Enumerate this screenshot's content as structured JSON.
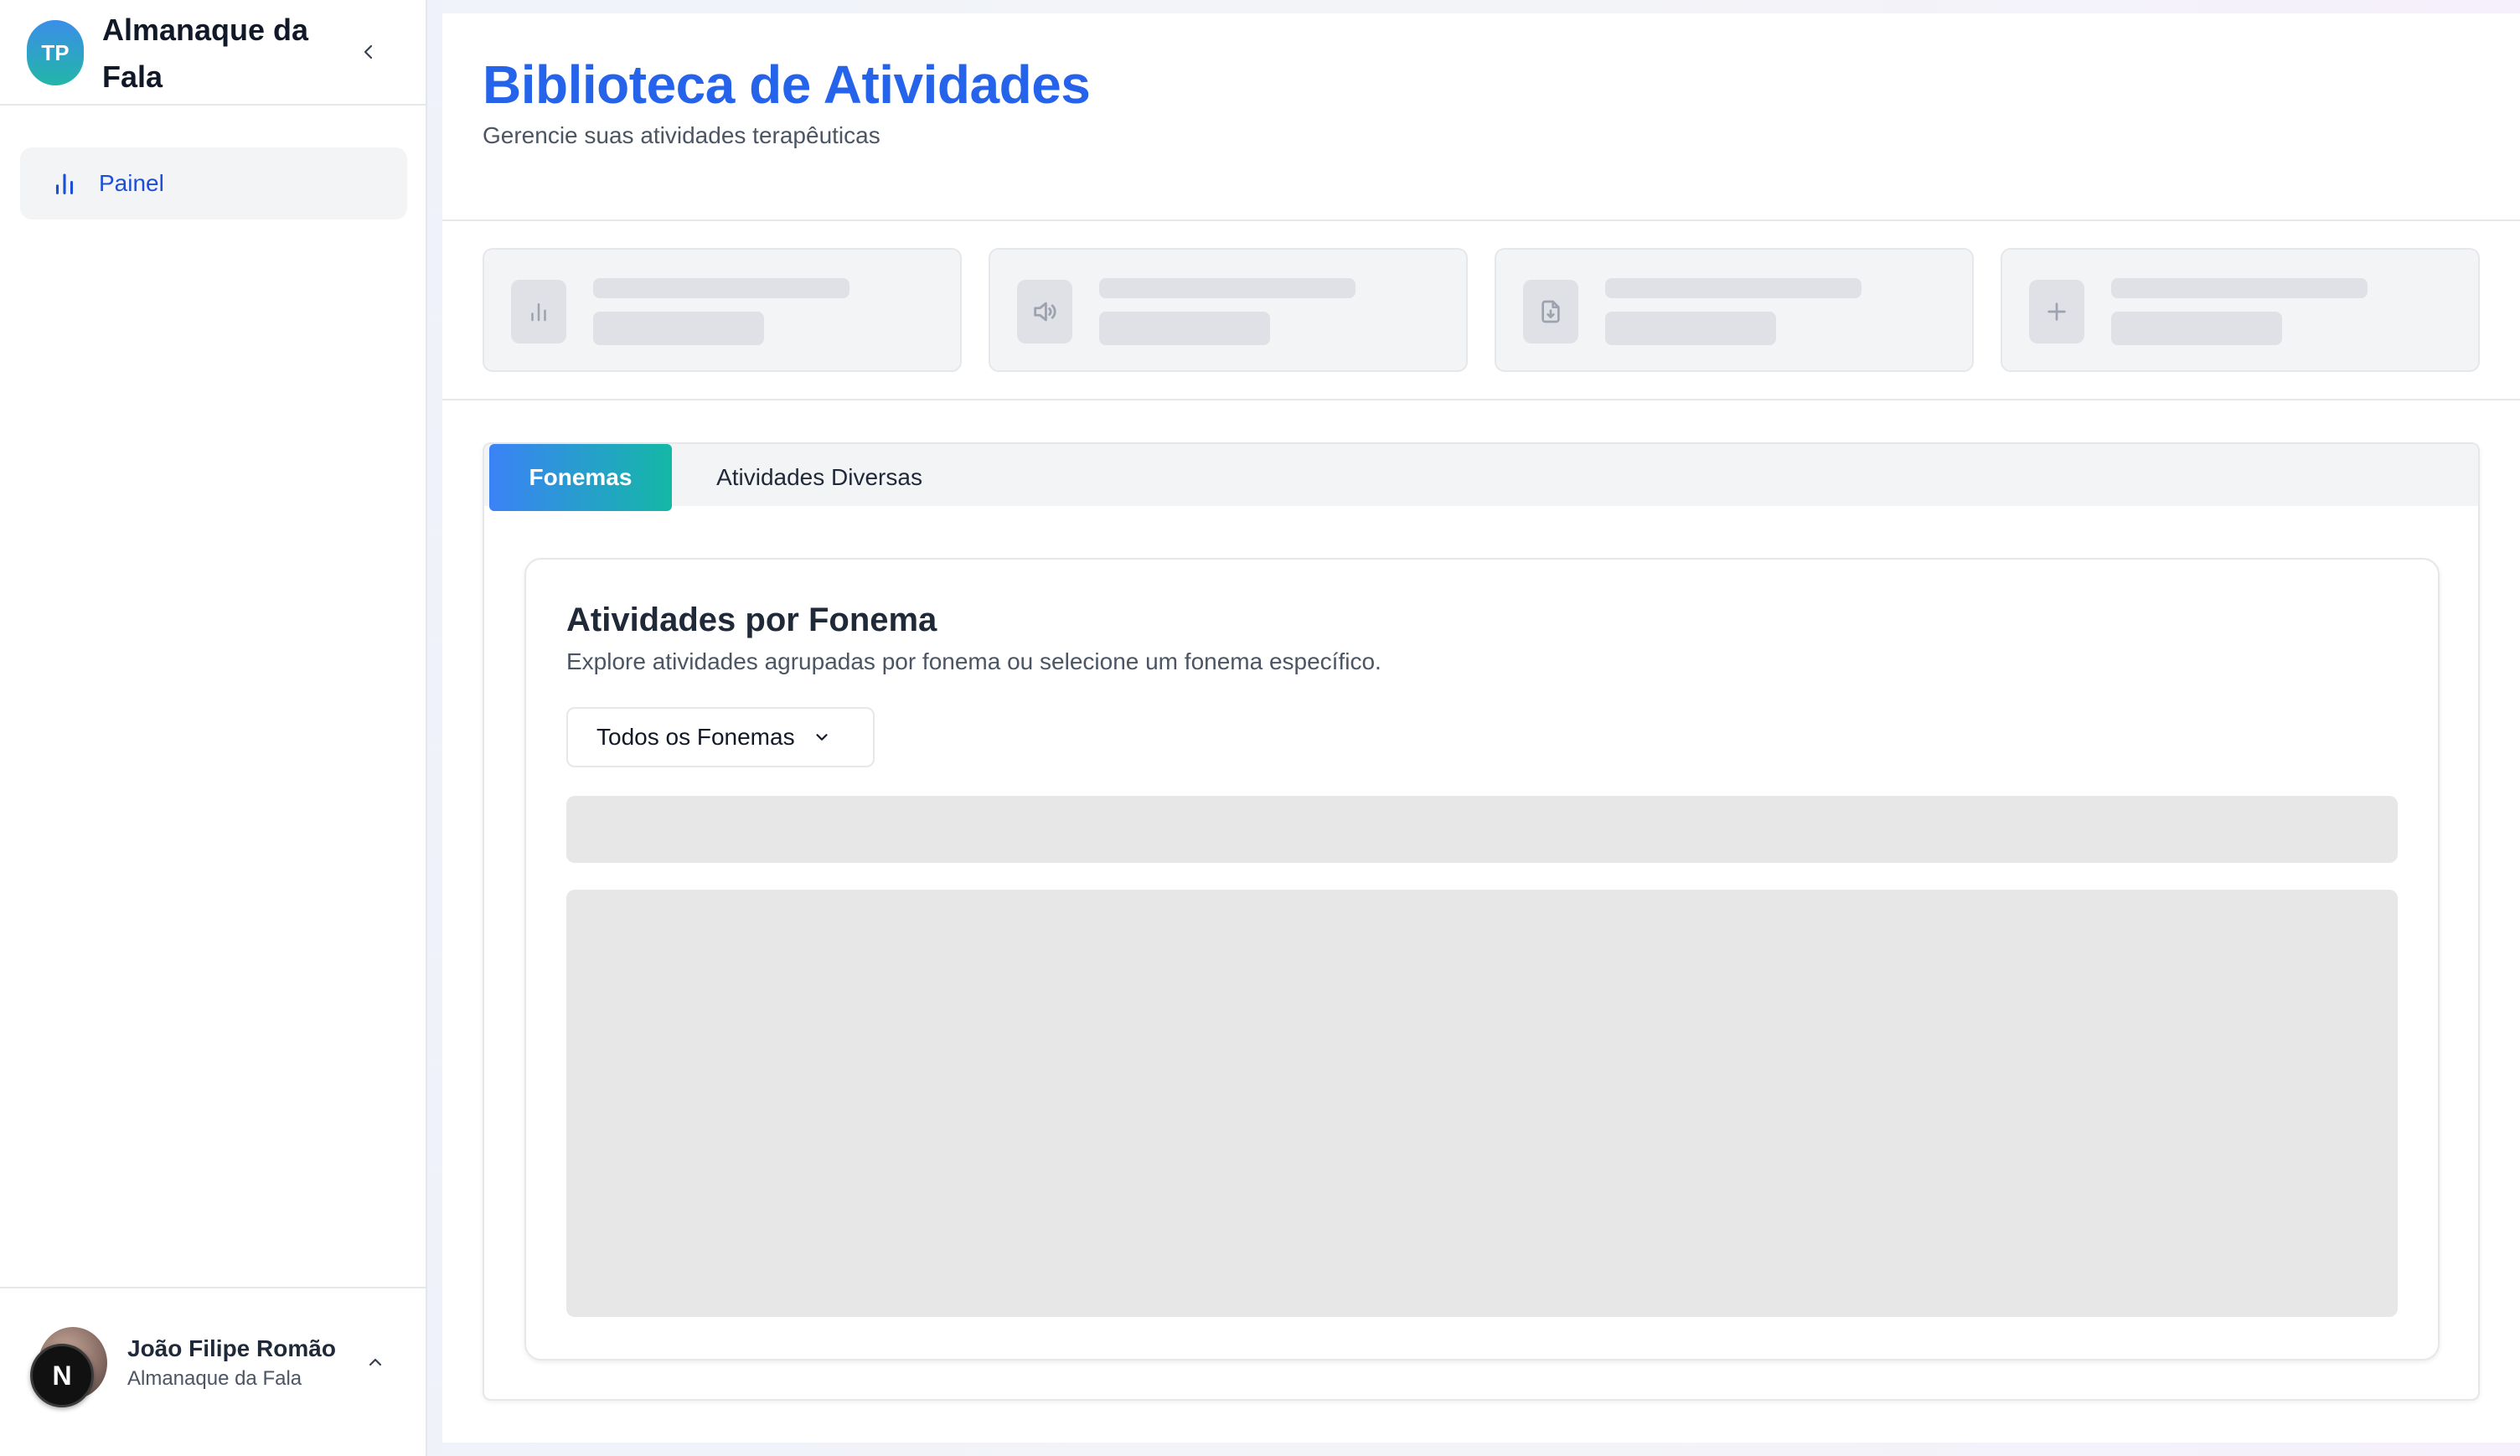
{
  "sidebar": {
    "logo_text": "TP",
    "app_name": "Almanaque da Fala",
    "collapse_icon": "chevron-left-icon",
    "nav": [
      {
        "label": "Painel",
        "icon": "bar-chart-icon"
      }
    ],
    "user": {
      "name": "João Filipe Romão",
      "org": "Almanaque da Fala",
      "badge": "N",
      "toggle_icon": "chevron-up-icon"
    }
  },
  "header": {
    "title": "Biblioteca de Atividades",
    "subtitle": "Gerencie suas atividades terapêuticas"
  },
  "stats": [
    {
      "icon": "bar-chart-icon"
    },
    {
      "icon": "volume-icon"
    },
    {
      "icon": "file-download-icon"
    },
    {
      "icon": "plus-icon"
    }
  ],
  "tabs": [
    {
      "label": "Fonemas",
      "active": true
    },
    {
      "label": "Atividades Diversas",
      "active": false
    }
  ],
  "fonema_section": {
    "title": "Atividades por Fonema",
    "description": "Explore atividades agrupadas por fonema ou selecione um fonema específico.",
    "select_value": "Todos os Fonemas",
    "select_icon": "chevron-down-icon"
  },
  "colors": {
    "accent_blue": "#2563eb",
    "tab_gradient_start": "#3b82f6",
    "tab_gradient_end": "#14b8a6",
    "nav_active_text": "#1d4ed8"
  }
}
